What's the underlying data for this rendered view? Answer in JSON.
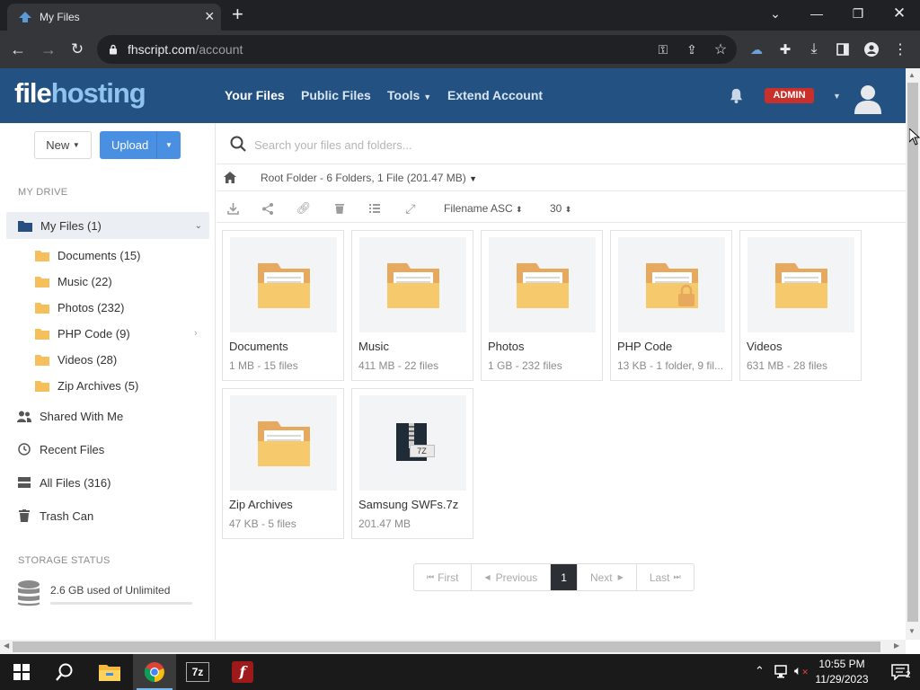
{
  "browser": {
    "tab_title": "My Files",
    "url_host": "fhscript.com",
    "url_path": "/account"
  },
  "header": {
    "logo_part1": "file",
    "logo_part2": "hosting",
    "nav": [
      "Your Files",
      "Public Files",
      "Tools",
      "Extend Account"
    ],
    "admin_badge": "ADMIN"
  },
  "sidebar": {
    "new_label": "New",
    "upload_label": "Upload",
    "my_drive_heading": "MY DRIVE",
    "my_files_label": "My Files (1)",
    "folders": [
      "Documents (15)",
      "Music (22)",
      "Photos (232)",
      "PHP Code (9)",
      "Videos (28)",
      "Zip Archives (5)"
    ],
    "links": [
      "Shared With Me",
      "Recent Files",
      "All Files (316)",
      "Trash Can"
    ],
    "storage_heading": "STORAGE STATUS",
    "storage_text": "2.6 GB used of Unlimited",
    "storage_used_fraction": 0
  },
  "main": {
    "search_placeholder": "Search your files and folders...",
    "breadcrumb": "Root Folder - 6 Folders, 1 File (201.47 MB)",
    "sort_label": "Filename ASC",
    "per_page": "30",
    "items": [
      {
        "name": "Documents",
        "meta": "1 MB - 15 files",
        "type": "folder"
      },
      {
        "name": "Music",
        "meta": "411 MB - 22 files",
        "type": "folder"
      },
      {
        "name": "Photos",
        "meta": "1 GB - 232 files",
        "type": "folder"
      },
      {
        "name": "PHP Code",
        "meta": "13 KB - 1 folder, 9 fil...",
        "type": "folder-locked"
      },
      {
        "name": "Videos",
        "meta": "631 MB - 28 files",
        "type": "folder"
      },
      {
        "name": "Zip Archives",
        "meta": "47 KB - 5 files",
        "type": "folder"
      },
      {
        "name": "Samsung SWFs.7z",
        "meta": "201.47 MB",
        "type": "archive",
        "badge": "7Z"
      }
    ],
    "pagination": {
      "first": "First",
      "previous": "Previous",
      "current": "1",
      "next": "Next",
      "last": "Last"
    }
  },
  "taskbar": {
    "time": "10:55 PM",
    "date": "11/29/2023",
    "notification_count": "2",
    "sevenzip_label": "7z"
  },
  "colors": {
    "header_bg": "#235182",
    "upload_btn": "#4a90e2",
    "admin_badge": "#c9302c",
    "folder": "#f7c96d"
  }
}
